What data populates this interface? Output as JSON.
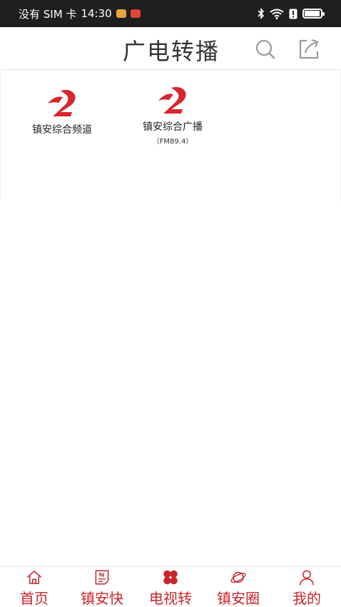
{
  "status_bar": {
    "carrier": "没有 SIM 卡",
    "time": "14:30",
    "notification_icons": [
      "weibo-icon",
      "app-icon"
    ],
    "right_icons": [
      "bluetooth-icon",
      "wifi-icon",
      "alert-icon",
      "battery-icon"
    ],
    "battery_level": 0.95
  },
  "header": {
    "title": "广电转播",
    "search_icon": "search-icon",
    "share_icon": "share-icon"
  },
  "channels": [
    {
      "name": "镇安综合频道",
      "sub": ""
    },
    {
      "name": "镇安综合广播",
      "sub": "（FM89.4）"
    }
  ],
  "tab_bar": {
    "items": [
      {
        "label": "首页",
        "icon": "home-icon"
      },
      {
        "label": "镇安快",
        "icon": "news-icon"
      },
      {
        "label": "电视转",
        "icon": "clover-icon"
      },
      {
        "label": "镇安圈",
        "icon": "planet-icon"
      },
      {
        "label": "我的",
        "icon": "user-icon"
      }
    ]
  },
  "colors": {
    "accent": "#c8252c",
    "status_bar_bg": "#1f1f1f",
    "title_text": "#333333"
  }
}
